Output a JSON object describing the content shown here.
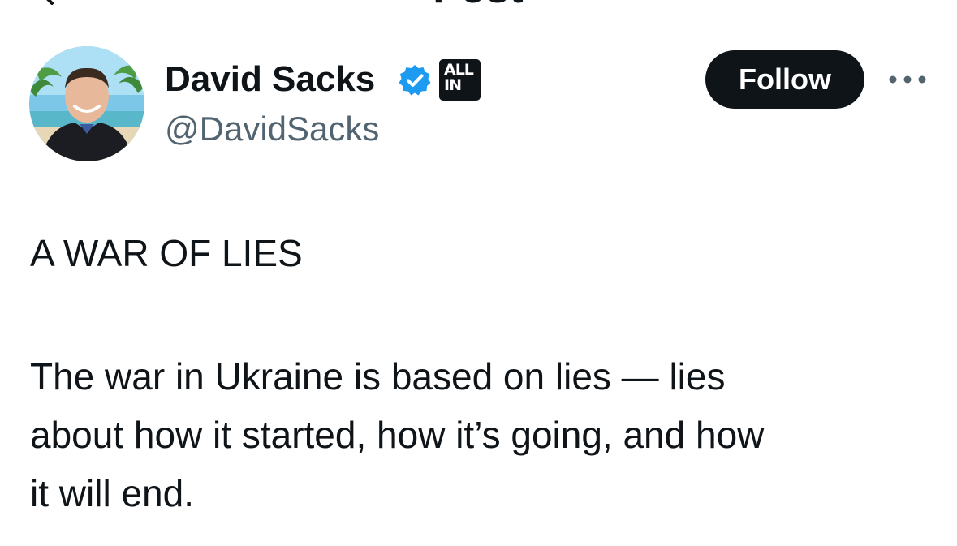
{
  "header": {
    "title": "Post",
    "back_icon": "chevron-left-icon"
  },
  "author": {
    "display_name": "David Sacks",
    "handle": "@DavidSacks",
    "verified_icon": "verified-badge-icon",
    "verified_color": "#1d9bf0",
    "affiliate_badge": {
      "line1": "ALL",
      "line2": "IN"
    },
    "follow_label": "Follow",
    "more_icon": "more-horizontal-icon"
  },
  "post": {
    "title": "A WAR OF LIES",
    "body_lines": [
      "The war in Ukraine is based on lies — lies",
      "about how it started, how it’s going, and how",
      "it will end."
    ]
  },
  "colors": {
    "text": "#0f1419",
    "secondary_text": "#536471",
    "button_bg": "#0f1419",
    "button_text": "#ffffff",
    "accent": "#1d9bf0"
  }
}
